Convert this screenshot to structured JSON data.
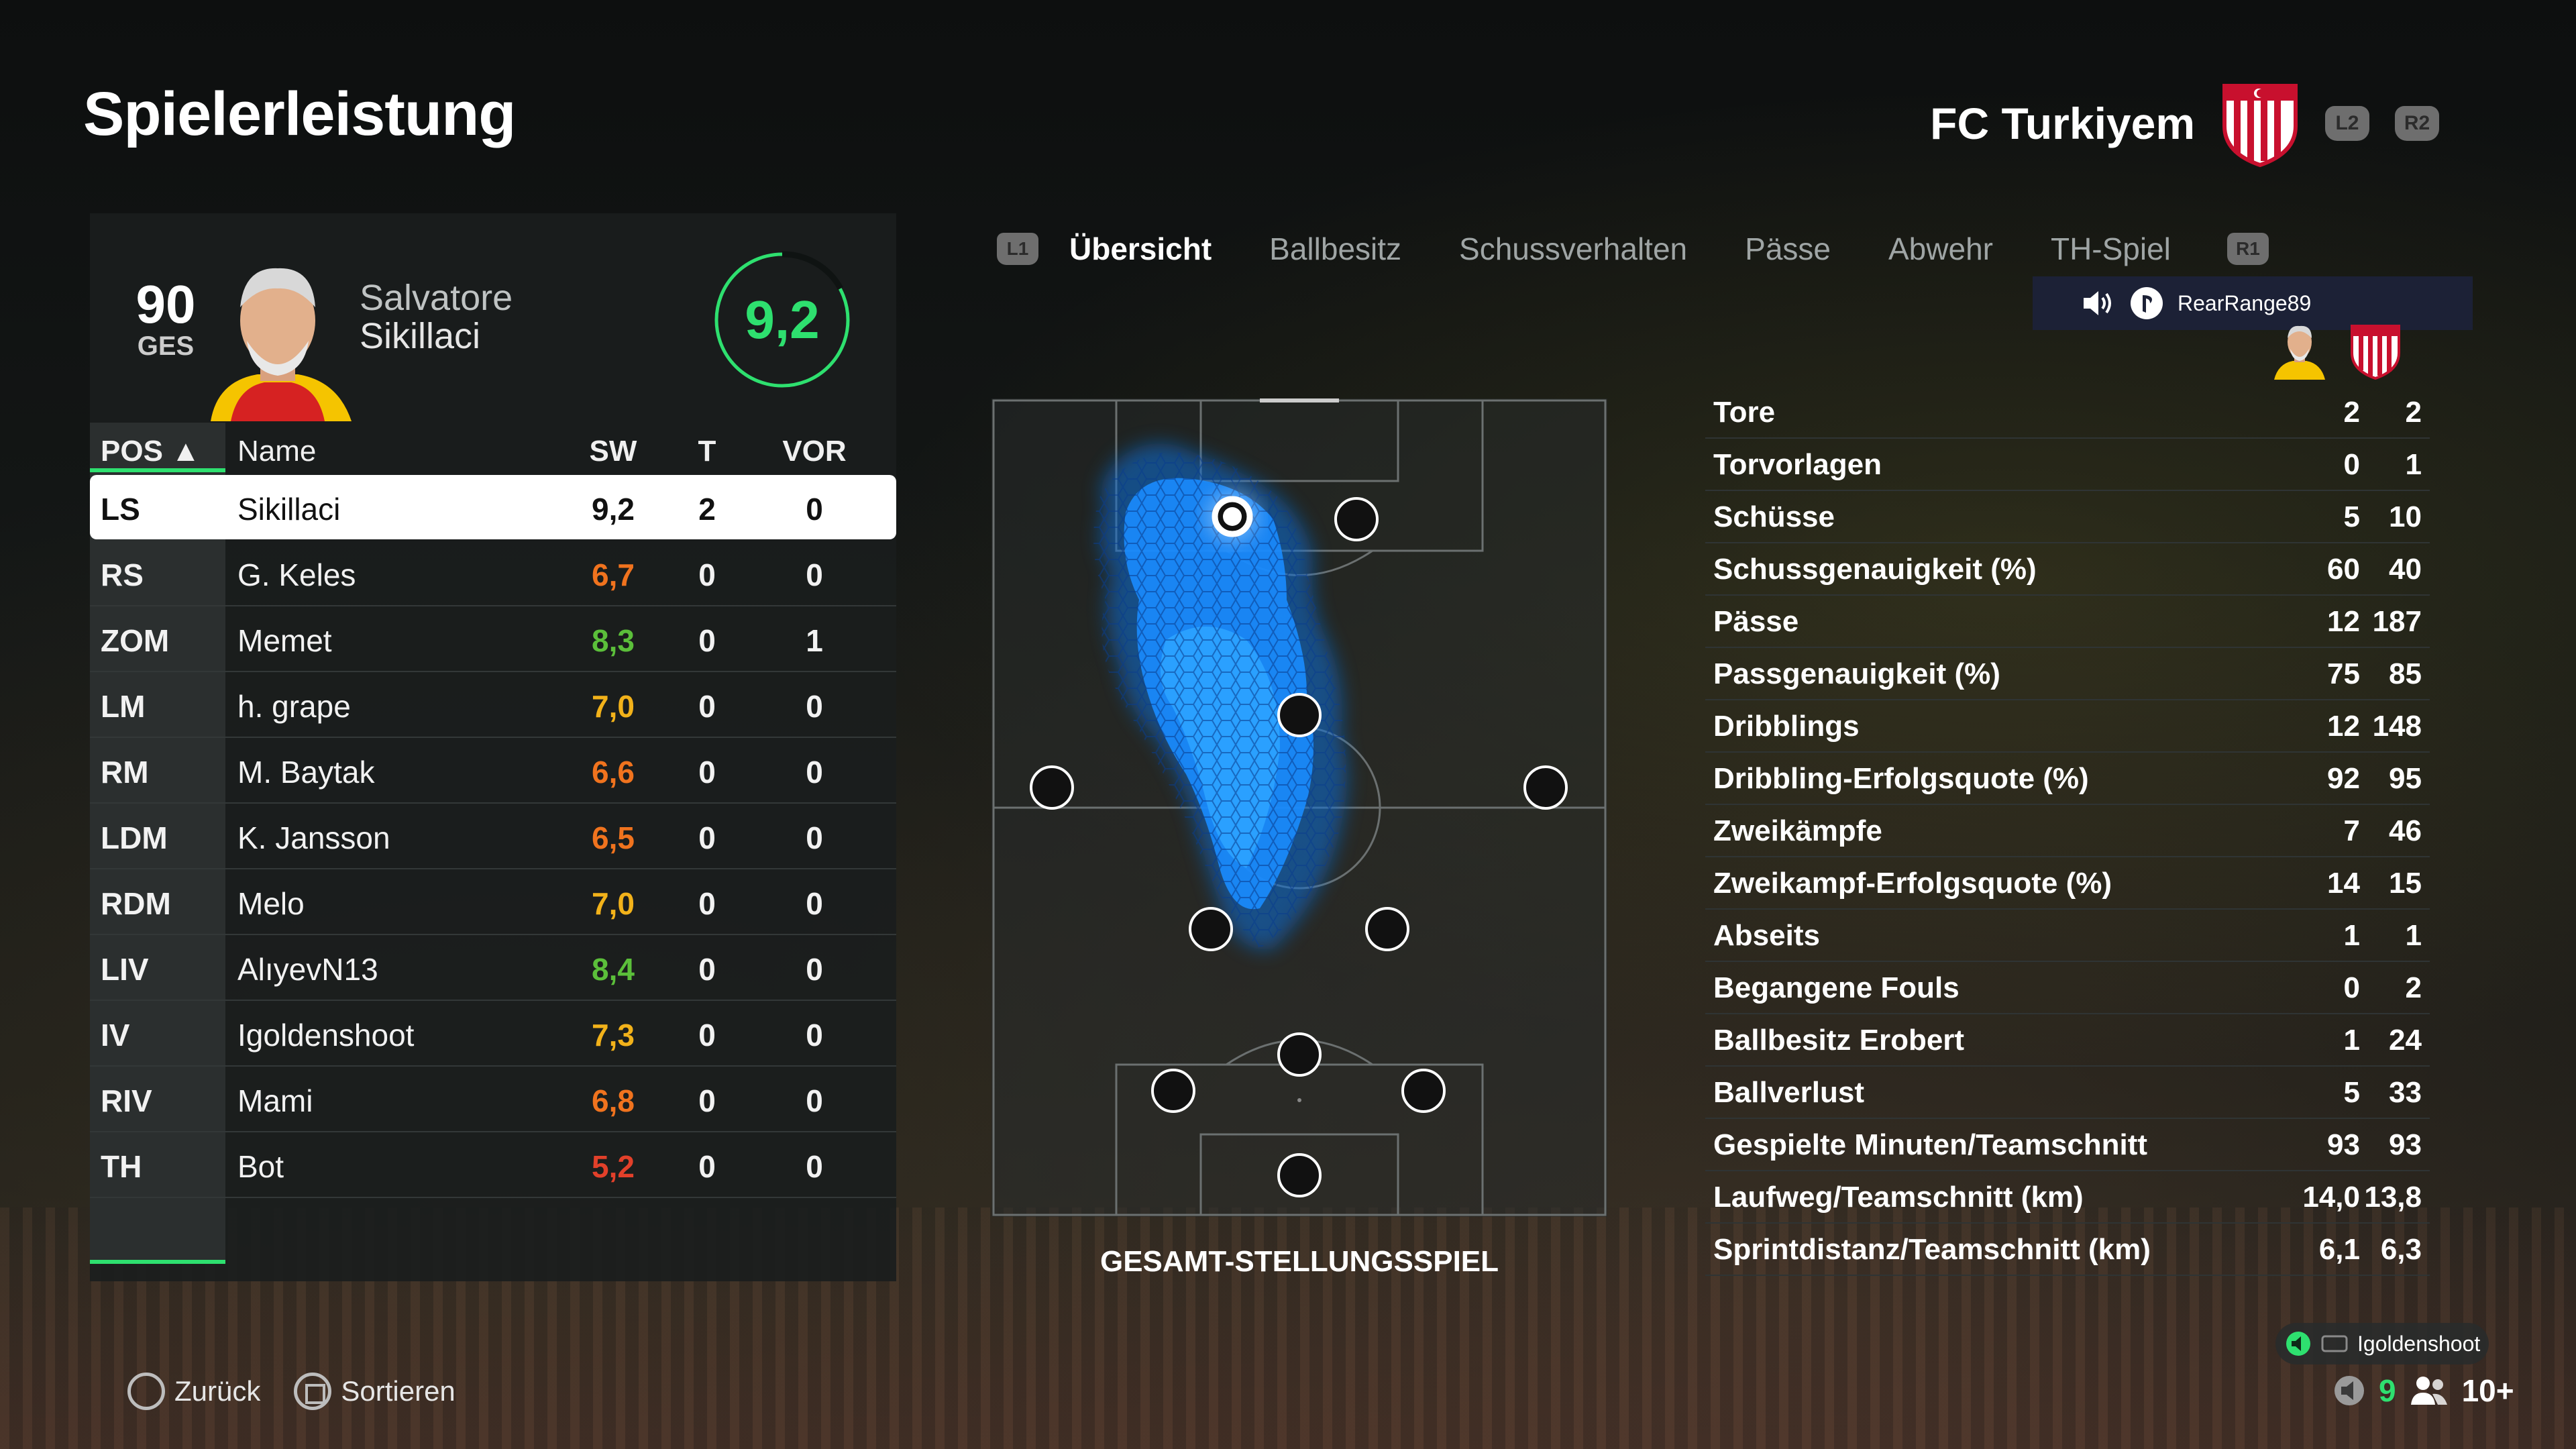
{
  "header": {
    "title": "Spielerleistung",
    "club_name": "FC Turkiyem",
    "btn_l2": "L2",
    "btn_r2": "R2"
  },
  "player": {
    "overall": "90",
    "overall_label": "GES",
    "first_name": "Salvatore",
    "last_name": "Sikillaci",
    "rating": "9,2"
  },
  "table": {
    "headers": {
      "pos": "POS ▲",
      "name": "Name",
      "sw": "SW",
      "t": "T",
      "vor": "VOR"
    },
    "rows": [
      {
        "pos": "LS",
        "name": "Sikillaci",
        "sw": "9,2",
        "t": "2",
        "vor": "0",
        "sw_color": "#111111"
      },
      {
        "pos": "RS",
        "name": "G. Keles",
        "sw": "6,7",
        "t": "0",
        "vor": "0",
        "sw_color": "#f0731e"
      },
      {
        "pos": "ZOM",
        "name": "Memet",
        "sw": "8,3",
        "t": "0",
        "vor": "1",
        "sw_color": "#5bbf3a"
      },
      {
        "pos": "LM",
        "name": "h. grape",
        "sw": "7,0",
        "t": "0",
        "vor": "0",
        "sw_color": "#f2b21a"
      },
      {
        "pos": "RM",
        "name": "M. Baytak",
        "sw": "6,6",
        "t": "0",
        "vor": "0",
        "sw_color": "#f0731e"
      },
      {
        "pos": "LDM",
        "name": "K. Jansson",
        "sw": "6,5",
        "t": "0",
        "vor": "0",
        "sw_color": "#f0731e"
      },
      {
        "pos": "RDM",
        "name": "Melo",
        "sw": "7,0",
        "t": "0",
        "vor": "0",
        "sw_color": "#f2b21a"
      },
      {
        "pos": "LIV",
        "name": "AlıyevN13",
        "sw": "8,4",
        "t": "0",
        "vor": "0",
        "sw_color": "#5bbf3a"
      },
      {
        "pos": "IV",
        "name": "Igoldenshoot",
        "sw": "7,3",
        "t": "0",
        "vor": "0",
        "sw_color": "#f2b21a"
      },
      {
        "pos": "RIV",
        "name": "Mami",
        "sw": "6,8",
        "t": "0",
        "vor": "0",
        "sw_color": "#f0731e"
      },
      {
        "pos": "TH",
        "name": "Bot",
        "sw": "5,2",
        "t": "0",
        "vor": "0",
        "sw_color": "#e2402a"
      }
    ]
  },
  "tabs": {
    "btn_l1": "L1",
    "btn_r1": "R1",
    "items": [
      "Übersicht",
      "Ballbesitz",
      "Schussverhalten",
      "Pässe",
      "Abwehr",
      "TH-Spiel"
    ],
    "active": 0
  },
  "user_bar": {
    "username": "RearRange89"
  },
  "pitch": {
    "caption": "GESAMT-STELLUNGSSPIEL"
  },
  "stats": [
    {
      "label": "Tore",
      "player": "2",
      "team": "2"
    },
    {
      "label": "Torvorlagen",
      "player": "0",
      "team": "1"
    },
    {
      "label": "Schüsse",
      "player": "5",
      "team": "10"
    },
    {
      "label": "Schussgenauigkeit (%)",
      "player": "60",
      "team": "40"
    },
    {
      "label": "Pässe",
      "player": "12",
      "team": "187"
    },
    {
      "label": "Passgenauigkeit (%)",
      "player": "75",
      "team": "85"
    },
    {
      "label": "Dribblings",
      "player": "12",
      "team": "148"
    },
    {
      "label": "Dribbling-Erfolgsquote (%)",
      "player": "92",
      "team": "95"
    },
    {
      "label": "Zweikämpfe",
      "player": "7",
      "team": "46"
    },
    {
      "label": "Zweikampf-Erfolgsquote (%)",
      "player": "14",
      "team": "15"
    },
    {
      "label": "Abseits",
      "player": "1",
      "team": "1"
    },
    {
      "label": "Begangene Fouls",
      "player": "0",
      "team": "2"
    },
    {
      "label": "Ballbesitz Erobert",
      "player": "1",
      "team": "24"
    },
    {
      "label": "Ballverlust",
      "player": "5",
      "team": "33"
    },
    {
      "label": "Gespielte Minuten/Teamschnitt",
      "player": "93",
      "team": "93"
    },
    {
      "label": "Laufweg/Teamschnitt (km)",
      "player": "14,0",
      "team": "13,8"
    },
    {
      "label": "Sprintdistanz/Teamschnitt (km)",
      "player": "6,1",
      "team": "6,3"
    }
  ],
  "footer": {
    "back_label": "Zurück",
    "sort_label": "Sortieren",
    "voice_user": "Igoldenshoot",
    "count_green": "9",
    "count_players": "10+"
  },
  "colors": {
    "accent_green": "#2ee06f",
    "heatmap_blue": "#1a8cff"
  },
  "icons": [
    "speaker-icon",
    "playstation-icon",
    "circle-button-icon",
    "square-button-icon",
    "microphone-icon",
    "people-icon"
  ]
}
